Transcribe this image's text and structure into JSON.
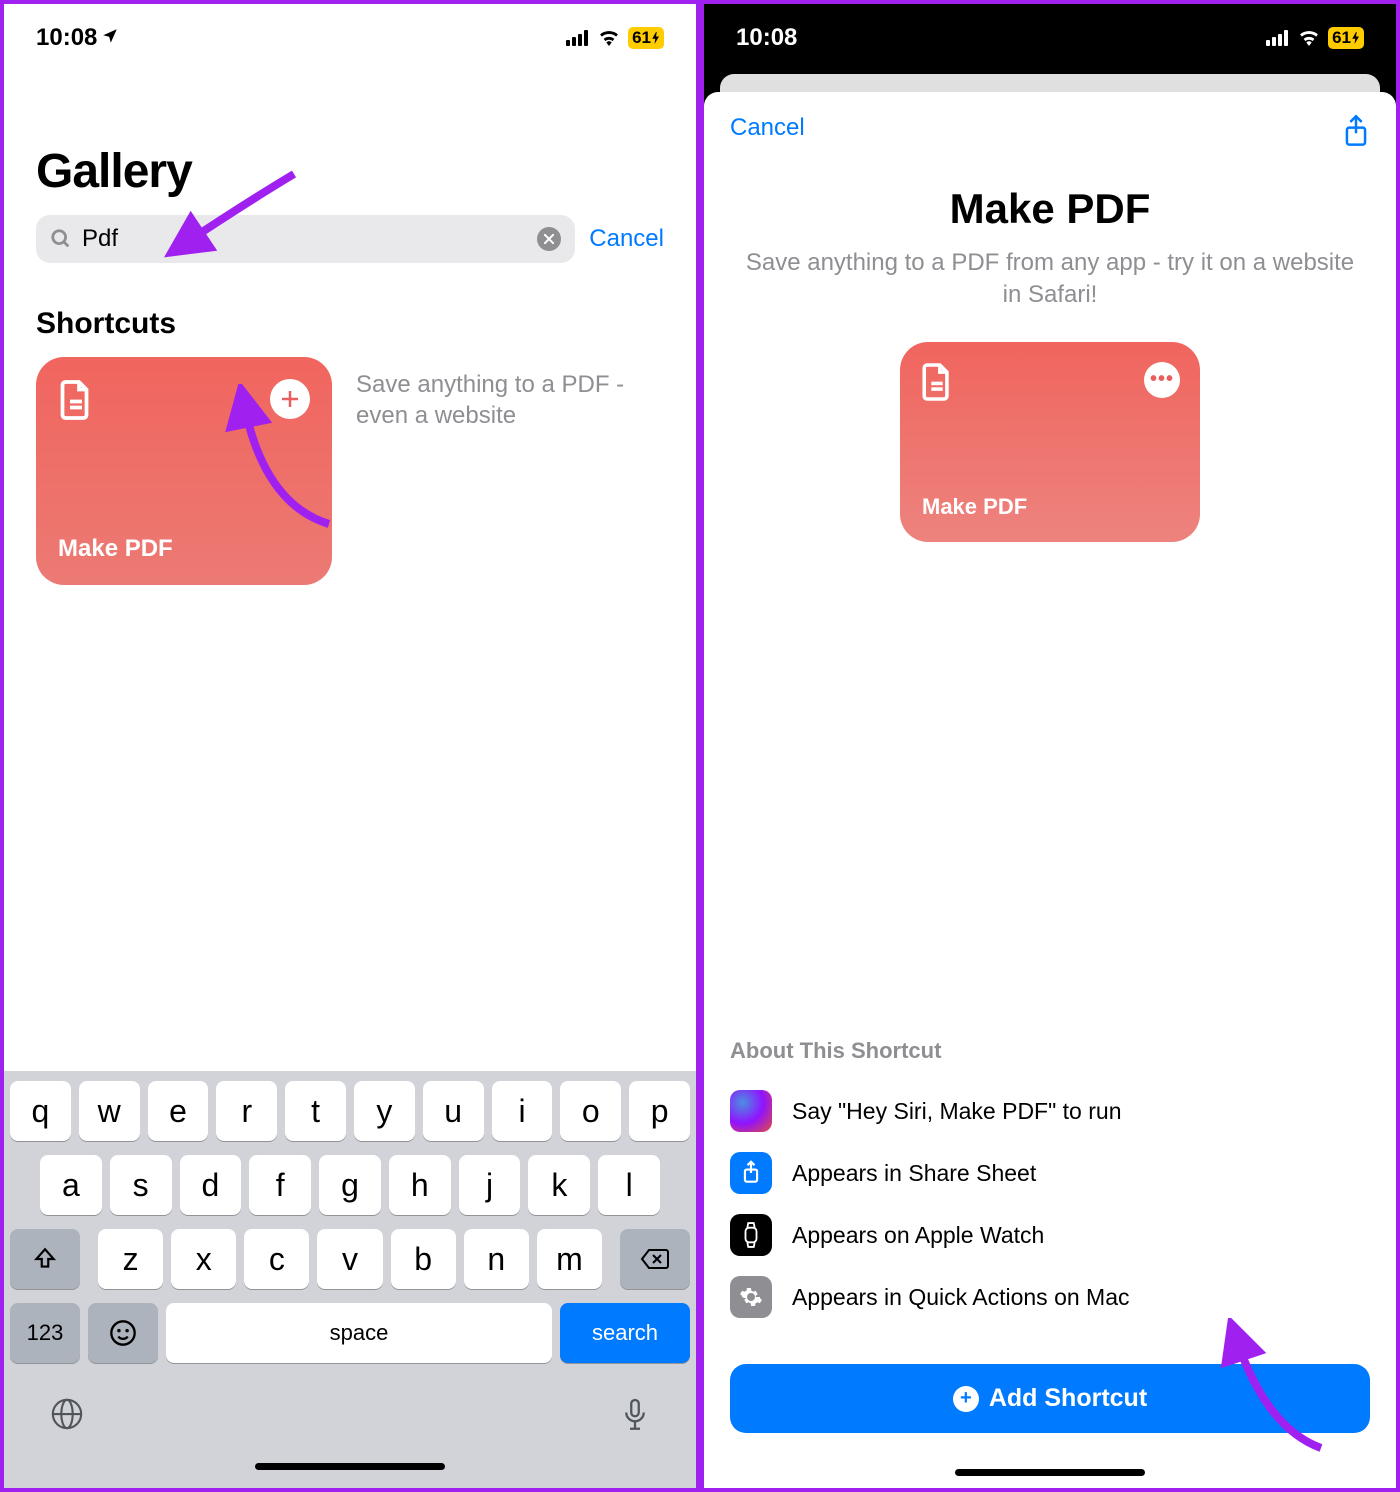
{
  "statusBar": {
    "time": "10:08",
    "battery": "61"
  },
  "left": {
    "pageTitle": "Gallery",
    "searchValue": "Pdf",
    "cancelLabel": "Cancel",
    "sectionTitle": "Shortcuts",
    "card": {
      "label": "Make PDF"
    },
    "cardDescription": "Save anything to a PDF - even a website",
    "keyboard": {
      "row1": [
        "q",
        "w",
        "e",
        "r",
        "t",
        "y",
        "u",
        "i",
        "o",
        "p"
      ],
      "row2": [
        "a",
        "s",
        "d",
        "f",
        "g",
        "h",
        "j",
        "k",
        "l"
      ],
      "row3": [
        "z",
        "x",
        "c",
        "v",
        "b",
        "n",
        "m"
      ],
      "numKey": "123",
      "spaceKey": "space",
      "searchKey": "search"
    }
  },
  "right": {
    "cancelLabel": "Cancel",
    "title": "Make PDF",
    "subtitle": "Save anything to a PDF from any app - try it on a website in Safari!",
    "card": {
      "label": "Make PDF"
    },
    "aboutTitle": "About This Shortcut",
    "aboutItems": [
      {
        "text": "Say \"Hey Siri, Make PDF\" to run",
        "icon": "siri"
      },
      {
        "text": "Appears in Share Sheet",
        "icon": "share"
      },
      {
        "text": "Appears on Apple Watch",
        "icon": "watch"
      },
      {
        "text": "Appears in Quick Actions on Mac",
        "icon": "gear"
      }
    ],
    "addButton": "Add Shortcut"
  }
}
